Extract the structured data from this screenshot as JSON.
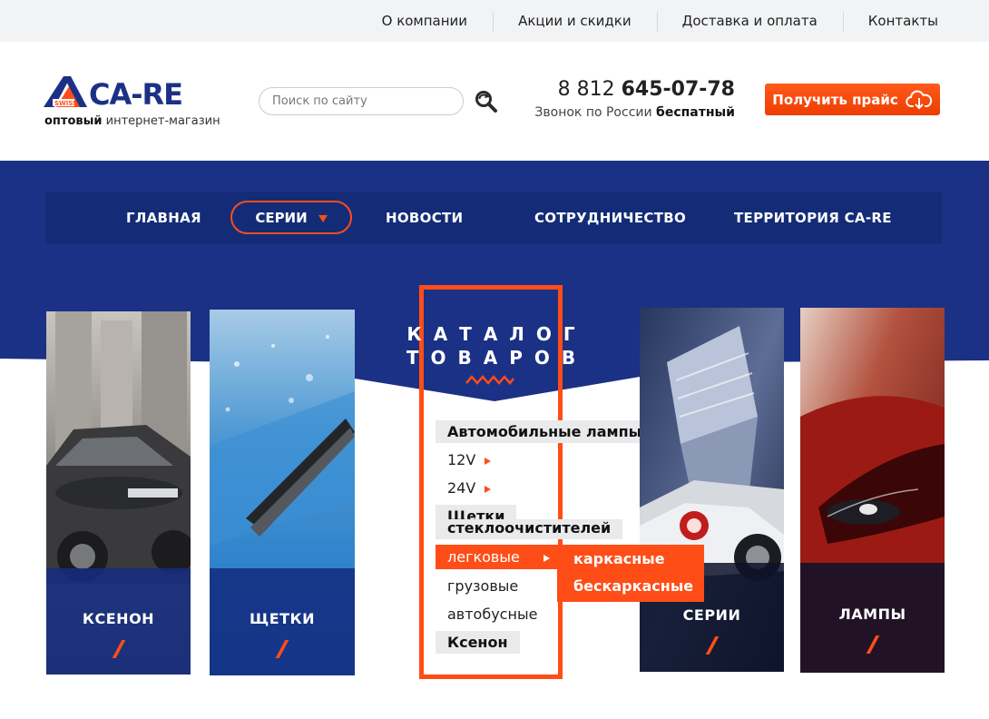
{
  "topnav": {
    "items": [
      "О компании",
      "Акции и скидки",
      "Доставка и оплата",
      "Контакты"
    ]
  },
  "header": {
    "logo_text": "CA-RE",
    "logo_swiss": "SWISS",
    "tagline_bold": "оптовый",
    "tagline_rest": " интернет-магазин",
    "search": {
      "placeholder": "Поиск по сайту",
      "value": ""
    },
    "phone_prefix": "8 812 ",
    "phone_main": "645-07-78",
    "phone_note_rest": "Звонок по России ",
    "phone_note_bold": "беспатный",
    "price_button": "Получить прайс"
  },
  "nav": {
    "items": [
      "ГЛАВНАЯ",
      "СЕРИИ",
      "НОВОСТИ",
      "СОТРУДНИЧЕСТВО",
      "ТЕРРИТОРИЯ CA-RE"
    ],
    "active_index": 1
  },
  "tiles": [
    {
      "label": "КСЕНОН"
    },
    {
      "label": "ЩЕТКИ"
    },
    {
      "label": "СЕРИИ"
    },
    {
      "label": "ЛАМПЫ"
    }
  ],
  "catalog": {
    "title_line1": "КАТАЛОГ",
    "title_line2": "ТОВАРОВ",
    "items": [
      {
        "label": "Автомобильные лампы",
        "kind": "heading"
      },
      {
        "label": "12V",
        "kind": "sub",
        "has_children": true
      },
      {
        "label": "24V",
        "kind": "sub",
        "has_children": true
      },
      {
        "label": "Щетки",
        "label2": "стеклоочистителей",
        "kind": "heading"
      },
      {
        "label": "легковые",
        "kind": "active",
        "has_children": true
      },
      {
        "label": "грузовые",
        "kind": "sub"
      },
      {
        "label": "автобусные",
        "kind": "sub"
      },
      {
        "label": "Ксенон",
        "kind": "heading"
      }
    ],
    "submenu": [
      "каркасные",
      "бескаркасные"
    ]
  },
  "colors": {
    "accent": "#ff4d17",
    "navy": "#1b3185",
    "navbar": "#142c77",
    "topbar": "#f2f3f5"
  }
}
